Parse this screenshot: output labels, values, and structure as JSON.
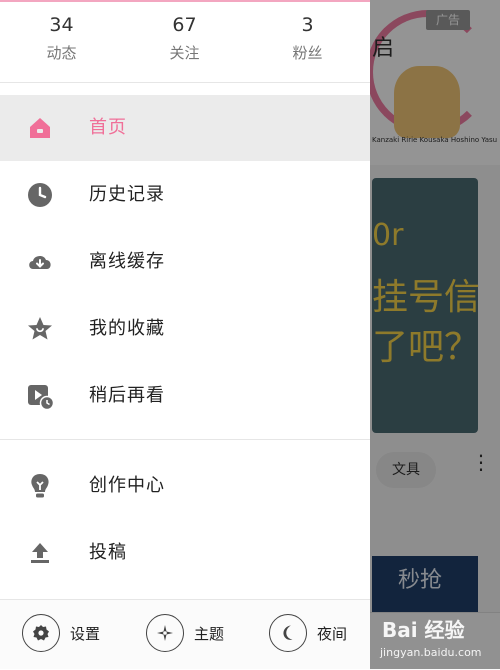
{
  "stats": [
    {
      "count": "34",
      "label": "动态"
    },
    {
      "count": "67",
      "label": "关注"
    },
    {
      "count": "3",
      "label": "粉丝"
    }
  ],
  "menu": [
    {
      "label": "首页",
      "icon": "home-icon",
      "active": true
    },
    {
      "label": "历史记录",
      "icon": "clock-icon",
      "active": false
    },
    {
      "label": "离线缓存",
      "icon": "cloud-download-icon",
      "active": false
    },
    {
      "label": "我的收藏",
      "icon": "star-icon",
      "active": false
    },
    {
      "label": "稍后再看",
      "icon": "watch-later-icon",
      "active": false
    }
  ],
  "menu2": [
    {
      "label": "创作中心",
      "icon": "lightbulb-icon"
    },
    {
      "label": "投稿",
      "icon": "upload-icon"
    }
  ],
  "bottom": [
    {
      "label": "设置",
      "icon": "gear-icon"
    },
    {
      "label": "主题",
      "icon": "theme-icon"
    },
    {
      "label": "夜间",
      "icon": "moon-icon"
    }
  ],
  "background": {
    "ad_label": "广告",
    "partial_title": "启",
    "caption": "Kanzaki Ririe Kousaka Hoshino Yasu",
    "card_line1": "0r",
    "card_line2": "挂号信",
    "card_line3": "了吧？",
    "tag": "文具",
    "banner": "秒抢"
  },
  "watermark": {
    "text": "Bai 经验",
    "sub": "jingyan.baidu.com"
  },
  "colors": {
    "accent": "#f06f98",
    "icon": "#666666"
  }
}
